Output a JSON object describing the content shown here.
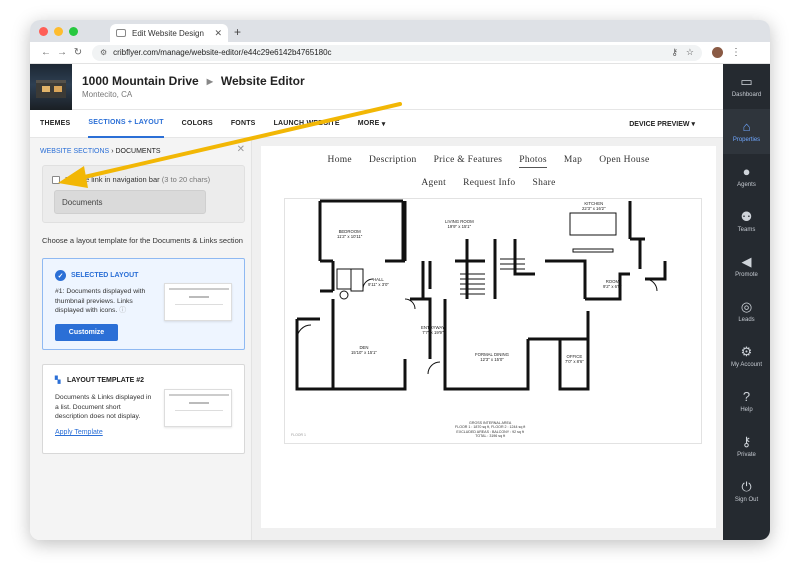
{
  "browser": {
    "tab_title": "Edit Website Design",
    "url": "cribflyer.com/manage/website-editor/e44c29e6142b4765180c"
  },
  "header": {
    "title": "1000 Mountain Drive",
    "subtitle": "Website Editor",
    "location": "Montecito, CA"
  },
  "menu": {
    "items": [
      "THEMES",
      "SECTIONS + LAYOUT",
      "COLORS",
      "FONTS",
      "LAUNCH WEBSITE",
      "MORE"
    ],
    "device_preview": "DEVICE PREVIEW"
  },
  "panel": {
    "breadcrumb_root": "WEBSITE SECTIONS",
    "breadcrumb_current": "DOCUMENTS",
    "nav_checkbox_label": "Include link in navigation bar",
    "nav_checkbox_hint": "(3 to 20 chars)",
    "nav_input_value": "Documents",
    "choose_text": "Choose a layout template for the Documents & Links section",
    "selected_card": {
      "title": "SELECTED LAYOUT",
      "desc": "#1: Documents displayed with thumbnail previews. Links displayed with icons.",
      "button": "Customize"
    },
    "template2_card": {
      "title": "LAYOUT TEMPLATE #2",
      "desc": "Documents & Links displayed in a list. Document short description does not display.",
      "link": "Apply Template"
    }
  },
  "site_nav": {
    "row1": [
      "Home",
      "Description",
      "Price & Features",
      "Photos",
      "Map",
      "Open House"
    ],
    "row2": [
      "Agent",
      "Request Info",
      "Share"
    ],
    "active": "Photos"
  },
  "floorplan": {
    "rooms": [
      {
        "name": "BEDROOM",
        "size": "11'2\" x 10'11\""
      },
      {
        "name": "LIVING ROOM",
        "size": "19'9\" x 15'1\""
      },
      {
        "name": "KITCHEN",
        "size": "22'3\" x 16'2\""
      },
      {
        "name": "HALL",
        "size": "9'11\" x 3'0\""
      },
      {
        "name": "ROOM",
        "size": "9'2\" x 6'5\""
      },
      {
        "name": "ENTRYWAY",
        "size": "7'7\" x 19'9\""
      },
      {
        "name": "DEN",
        "size": "15'10\" x 15'1\""
      },
      {
        "name": "FORMAL DINING",
        "size": "12'3\" x 15'0\""
      },
      {
        "name": "OFFICE",
        "size": "7'0\" x 8'6\""
      }
    ],
    "area_lines": [
      "GROSS INTERNAL AREA",
      "FLOOR 1 : 1870 sq ft, FLOOR 2 : 1244 sq ft",
      "EXCLUDED AREAS : BALCONY : 92 sq ft",
      "TOTAL : 3196 sq ft"
    ],
    "floor_label": "FLOOR 1"
  },
  "rightnav": [
    {
      "label": "Dashboard",
      "icon": "dashboard-icon",
      "glyph": "▭"
    },
    {
      "label": "Properties",
      "icon": "properties-icon",
      "glyph": "⌂"
    },
    {
      "label": "Agents",
      "icon": "agent-icon",
      "glyph": "●"
    },
    {
      "label": "Teams",
      "icon": "teams-icon",
      "glyph": "⚉"
    },
    {
      "label": "Promote",
      "icon": "megaphone-icon",
      "glyph": "◀"
    },
    {
      "label": "Leads",
      "icon": "target-icon",
      "glyph": "◎"
    },
    {
      "label": "My Account",
      "icon": "gear-icon",
      "glyph": "⚙"
    },
    {
      "label": "Help",
      "icon": "help-icon",
      "glyph": "?"
    },
    {
      "label": "Private",
      "icon": "key-icon",
      "glyph": "⚷"
    },
    {
      "label": "Sign Out",
      "icon": "power-icon",
      "glyph": "⏻"
    }
  ],
  "colors": {
    "accent": "#2b6fd6",
    "sidebar": "#252a30",
    "arrow": "#f2b705"
  }
}
